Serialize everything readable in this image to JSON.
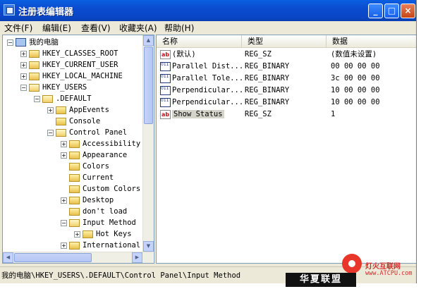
{
  "window": {
    "title": "注册表编辑器",
    "controls": {
      "minimize": "_",
      "maximize": "□",
      "close": "×"
    }
  },
  "menubar": [
    "文件(F)",
    "编辑(E)",
    "查看(V)",
    "收藏夹(A)",
    "帮助(H)"
  ],
  "tree": {
    "root": "我的电脑",
    "items": [
      {
        "label": "HKEY_CLASSES_ROOT",
        "depth": 1,
        "expander": "+"
      },
      {
        "label": "HKEY_CURRENT_USER",
        "depth": 1,
        "expander": "+"
      },
      {
        "label": "HKEY_LOCAL_MACHINE",
        "depth": 1,
        "expander": "+"
      },
      {
        "label": "HKEY_USERS",
        "depth": 1,
        "expander": "−"
      },
      {
        "label": ".DEFAULT",
        "depth": 2,
        "expander": "−"
      },
      {
        "label": "AppEvents",
        "depth": 3,
        "expander": "+"
      },
      {
        "label": "Console",
        "depth": 3,
        "expander": ""
      },
      {
        "label": "Control Panel",
        "depth": 3,
        "expander": "−"
      },
      {
        "label": "Accessibility",
        "depth": 4,
        "expander": "+"
      },
      {
        "label": "Appearance",
        "depth": 4,
        "expander": "+"
      },
      {
        "label": "Colors",
        "depth": 4,
        "expander": ""
      },
      {
        "label": "Current",
        "depth": 4,
        "expander": ""
      },
      {
        "label": "Custom Colors",
        "depth": 4,
        "expander": ""
      },
      {
        "label": "Desktop",
        "depth": 4,
        "expander": "+"
      },
      {
        "label": "don't load",
        "depth": 4,
        "expander": ""
      },
      {
        "label": "Input Method",
        "depth": 4,
        "expander": "−"
      },
      {
        "label": "Hot Keys",
        "depth": 5,
        "expander": "+"
      },
      {
        "label": "International",
        "depth": 4,
        "expander": "+"
      }
    ]
  },
  "list": {
    "headers": {
      "name": "名称",
      "type": "类型",
      "data": "数据"
    },
    "rows": [
      {
        "icon": "string-value-icon",
        "name": "(默认)",
        "type": "REG_SZ",
        "data": "(数值未设置)"
      },
      {
        "icon": "binary-value-icon",
        "name": "Parallel Dist...",
        "type": "REG_BINARY",
        "data": "00 00 00 00"
      },
      {
        "icon": "binary-value-icon",
        "name": "Parallel Tole...",
        "type": "REG_BINARY",
        "data": "3c 00 00 00"
      },
      {
        "icon": "binary-value-icon",
        "name": "Perpendicular...",
        "type": "REG_BINARY",
        "data": "10 00 00 00"
      },
      {
        "icon": "binary-value-icon",
        "name": "Perpendicular...",
        "type": "REG_BINARY",
        "data": "10 00 00 00"
      },
      {
        "icon": "string-value-icon",
        "name": "Show Status",
        "type": "REG_SZ",
        "data": "1"
      }
    ]
  },
  "statusbar": {
    "path": "我的电脑\\HKEY_USERS\\.DEFAULT\\Control Panel\\Input Method"
  },
  "watermark": {
    "site_cn": "灯火互联网",
    "site_url": "www.ATCPU.com",
    "badge": "华夏联盟"
  },
  "colors": {
    "titlebar": "#0a4bd0",
    "window_bg": "#ece9d8",
    "selection": "#d5d4cb"
  }
}
